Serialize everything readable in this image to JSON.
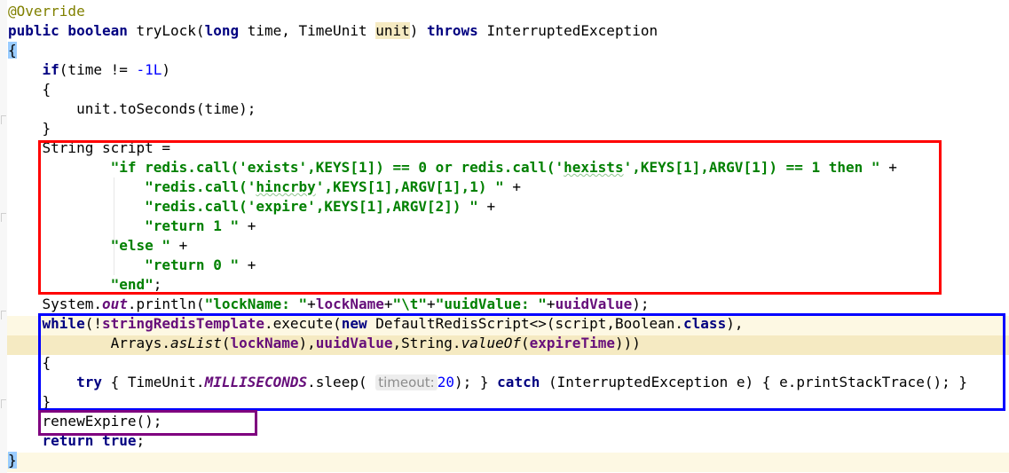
{
  "editor": {
    "theme_colors": {
      "keyword": "#000080",
      "string": "#008000",
      "field": "#660e7a",
      "number": "#0000ff",
      "annotation": "#808000",
      "current_line": "#fdf8e3",
      "param_highlight": "#f5eac2"
    },
    "annotation_marks": [
      {
        "color": "#ff0000",
        "label": ""
      },
      {
        "color": "#0000ff",
        "label": ""
      },
      {
        "color": "#7f007f",
        "label": ""
      }
    ],
    "inlay_hint": "timeout:",
    "code": {
      "l1": "@Override",
      "l2": {
        "a": "public boolean",
        "b": " tryLock(",
        "c": "long",
        "d": " time, TimeUnit ",
        "e": "unit",
        "f": ") ",
        "g": "throws",
        "h": " InterruptedException"
      },
      "l3": "{",
      "l4": {
        "a": "    ",
        "b": "if",
        "c": "(time != ",
        "d": "-1L",
        "e": ")"
      },
      "l5": "    {",
      "l6": "        unit.toSeconds(time);",
      "l7": "    }",
      "l8": "    String script =",
      "l9": {
        "a": "            ",
        "b": "\"if redis.call('exists',KEYS[1]) == 0 or redis.call('",
        "c": "hexists",
        "d": "',KEYS[1],ARGV[1]) == 1 then \"",
        "e": " +"
      },
      "l10": {
        "a": "                ",
        "b": "\"redis.call('",
        "c": "hincrby",
        "d": "',KEYS[1],ARGV[1],1) \"",
        "e": " +"
      },
      "l11": {
        "a": "                ",
        "b": "\"redis.call('expire',KEYS[1],ARGV[2]) \"",
        "c": " +"
      },
      "l12": {
        "a": "                ",
        "b": "\"return 1 \"",
        "c": " +"
      },
      "l13": {
        "a": "            ",
        "b": "\"else \"",
        "c": " +"
      },
      "l14": {
        "a": "                ",
        "b": "\"return 0 \"",
        "c": " +"
      },
      "l15": {
        "a": "            ",
        "b": "\"end\"",
        "c": ";"
      },
      "l16": {
        "a": "    System.",
        "b": "out",
        "c": ".println(",
        "d": "\"lockName: \"",
        "e": "+",
        "f": "lockName",
        "g": "+",
        "h": "\"\\t\"",
        "i": "+",
        "j": "\"uuidValue: \"",
        "k": "+",
        "l": "uuidValue",
        "m": ");"
      },
      "l17": {
        "a": "    ",
        "b": "while",
        "c": "(!",
        "d": "stringRedisTemplate",
        "e": ".execute(",
        "f": "new",
        "g": " DefaultRedisScript<>(script,Boolean.",
        "h": "class",
        "i": "),"
      },
      "l18": {
        "a": "            Arrays.",
        "b": "asList",
        "c": "(",
        "d": "lockName",
        "e": "),",
        "f": "uuidValue",
        "g": ",String.",
        "h": "valueOf",
        "i": "(",
        "j": "expireTime",
        "k": ")))"
      },
      "l19": "    {",
      "l20": {
        "a": "        ",
        "b": "try",
        "c": " { TimeUnit.",
        "d": "MILLISECONDS",
        "e": ".sleep( ",
        "f": "20",
        "g": "); } ",
        "h": "catch",
        "i": " (InterruptedException e) { e.printStackTrace(); }"
      },
      "l21": "    }",
      "l22": "    renewExpire();",
      "l23": {
        "a": "    ",
        "b": "return",
        "c": " ",
        "d": "true",
        "e": ";"
      },
      "l24": "}"
    }
  }
}
